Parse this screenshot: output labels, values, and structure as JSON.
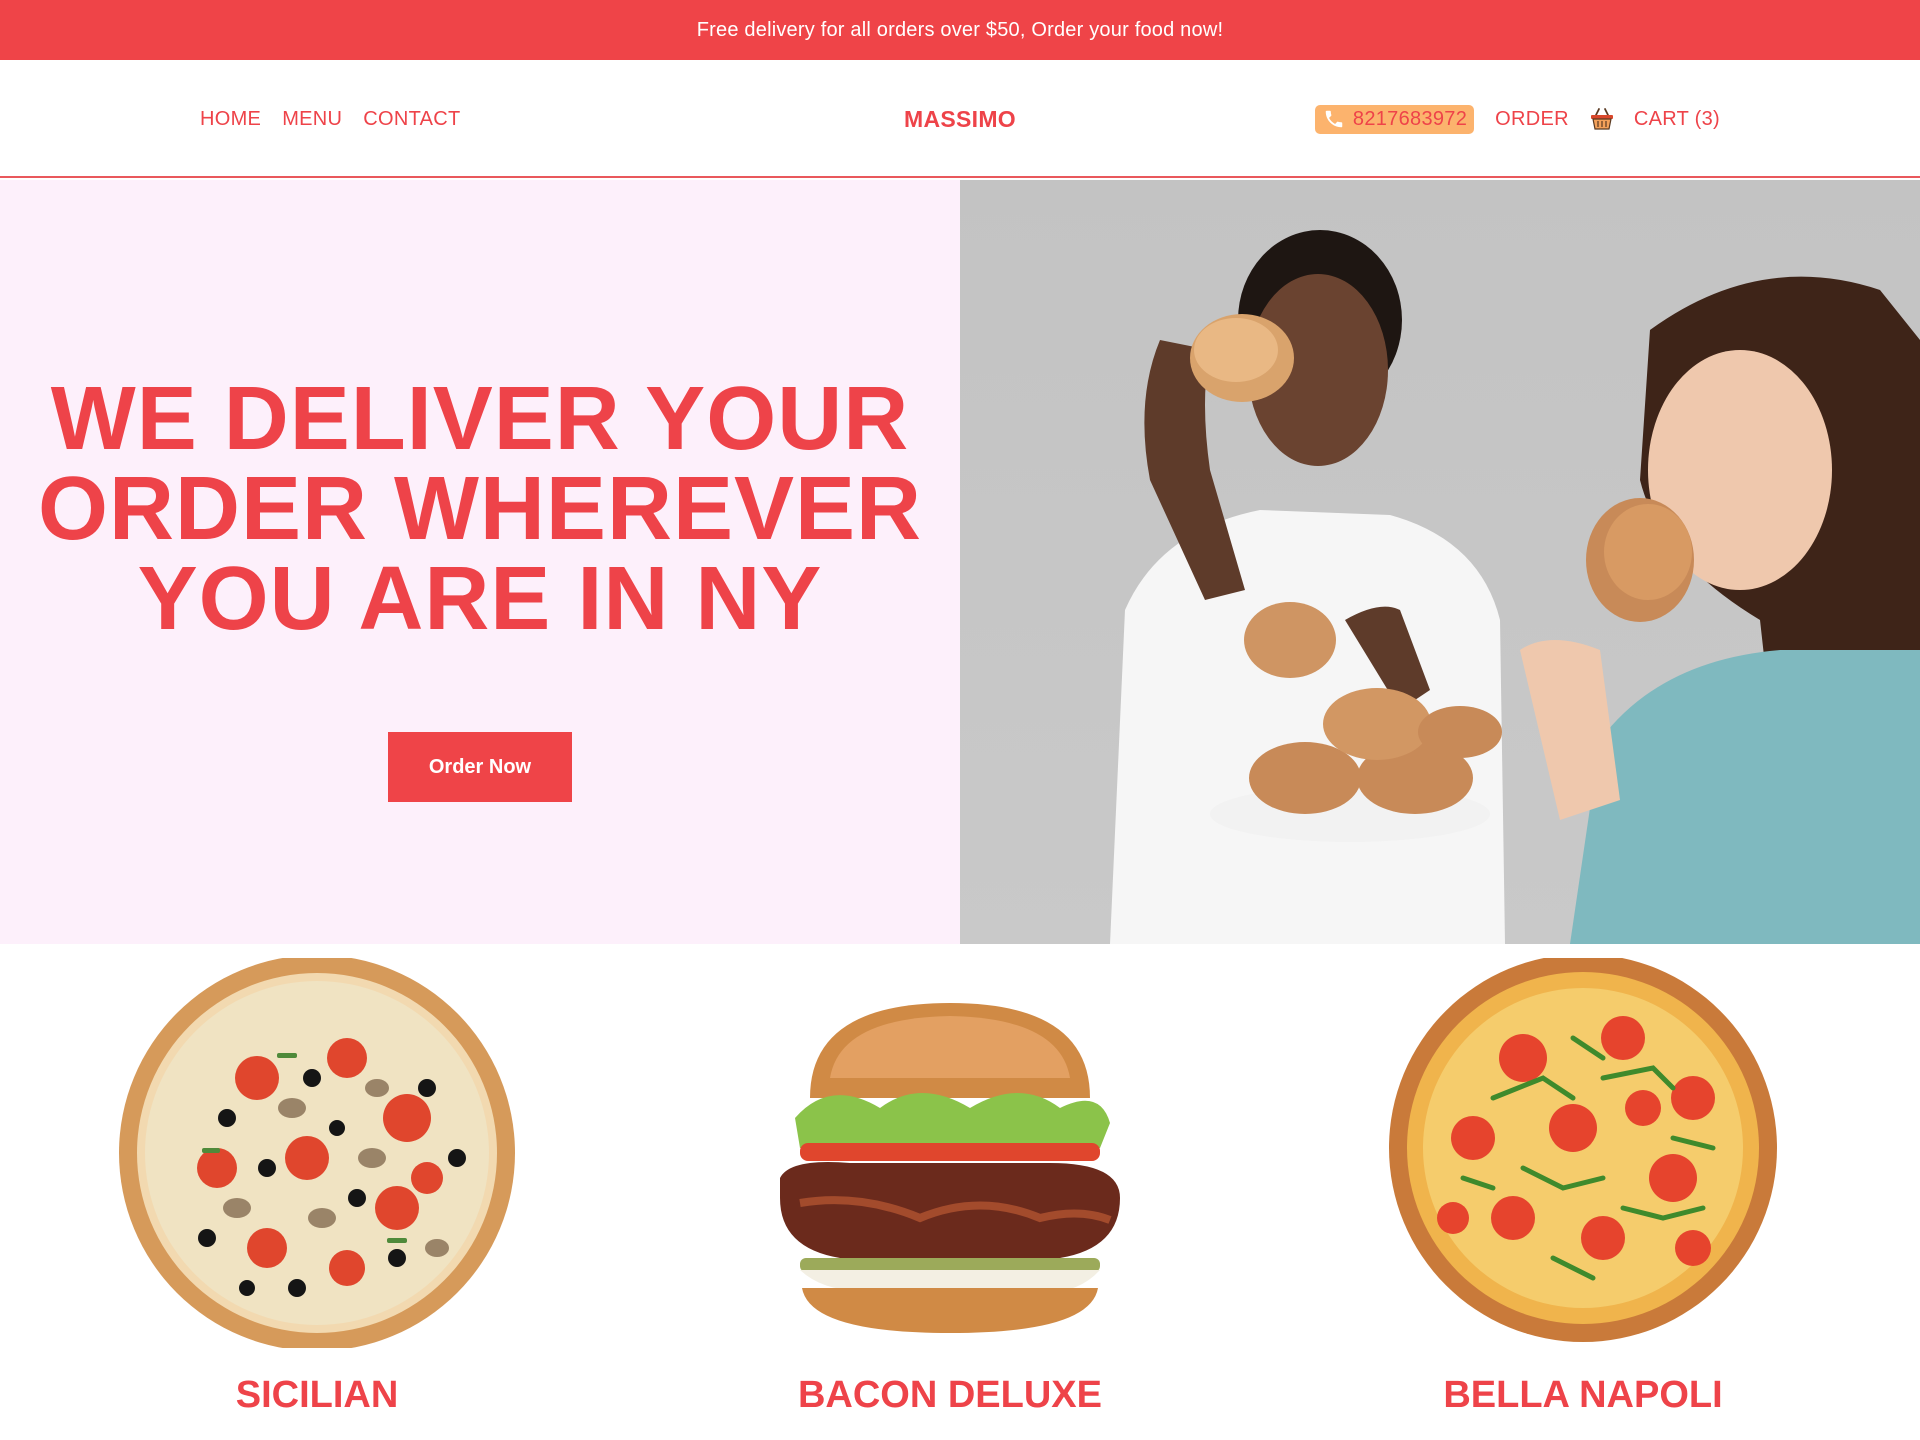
{
  "promo": {
    "text": "Free delivery for all orders over $50, Order your food now!"
  },
  "nav": {
    "links": [
      "HOME",
      "MENU",
      "CONTACT"
    ],
    "brand": "MASSIMO",
    "phone": "8217683972",
    "order_label": "ORDER",
    "cart_label": "CART (3)"
  },
  "hero": {
    "title_lines": [
      "WE DELIVER YOUR",
      "ORDER WHEREVER",
      "YOU ARE IN NY"
    ],
    "cta_label": "Order Now"
  },
  "products": [
    {
      "name": "SICILIAN",
      "icon": "pizza-icon"
    },
    {
      "name": "BACON DELUXE",
      "icon": "burger-icon"
    },
    {
      "name": "BELLA NAPOLI",
      "icon": "pizza-icon"
    }
  ],
  "colors": {
    "accent": "#ef4448",
    "hero_bg": "#fdf0fb",
    "phone_bg": "#fcb36d"
  }
}
